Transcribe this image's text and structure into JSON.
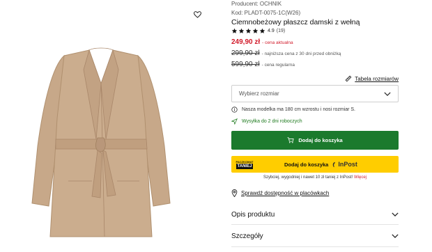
{
  "gallery": {
    "wishlist_icon": "heart-outline-icon"
  },
  "product": {
    "producer": "Producent: OCHNIK",
    "code": "Kod: PLADT-0075-1C(W26)",
    "title": "Ciemnobeżowy płaszcz damski z wełną",
    "rating": {
      "value": "4.9",
      "count": "(19)",
      "stars": 5
    }
  },
  "prices": {
    "current": "249,90 zł",
    "current_label": "- cena aktualna",
    "lowest": "299,90 zł",
    "lowest_label": "- najniższa cena z 30 dni przed obniżką",
    "regular": "599,90 zł",
    "regular_label": "- cena regularna"
  },
  "size": {
    "table_link": "Tabela rozmiarów",
    "select_placeholder": "Wybierz rozmiar"
  },
  "notes": {
    "model": "Nasza modelka ma 180 cm wzrostu i nosi rozmiar S.",
    "shipping": "Wysyłka do 2 dni roboczych"
  },
  "buttons": {
    "add_to_cart": "Dodaj do koszyka",
    "inpost_add": "Dodaj do koszyka",
    "inpost_brand": "InPost",
    "inpost_badge_top": "PACZKOMAT",
    "inpost_badge_bottom": "TANIEJ"
  },
  "inpost_promo": {
    "text": "Szybciej, wygodniej i nawet 10 zł taniej z InPost!",
    "more": "Więcej"
  },
  "stores_link": "Sprawdź dostępność w placówkach",
  "accordion": {
    "description": "Opis produktu",
    "details": "Szczegóły"
  },
  "colors": {
    "accent_green": "#1b7a2d",
    "price_red": "#d11a2a",
    "inpost_yellow": "#ffcd00",
    "coat": "#c8a98a"
  }
}
